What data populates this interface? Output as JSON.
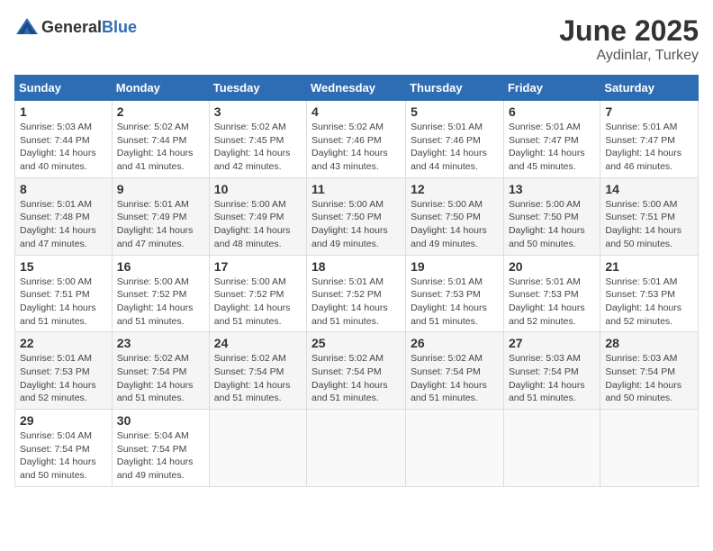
{
  "header": {
    "logo_general": "General",
    "logo_blue": "Blue",
    "month": "June 2025",
    "location": "Aydinlar, Turkey"
  },
  "weekdays": [
    "Sunday",
    "Monday",
    "Tuesday",
    "Wednesday",
    "Thursday",
    "Friday",
    "Saturday"
  ],
  "weeks": [
    [
      {
        "day": "1",
        "sunrise": "5:03 AM",
        "sunset": "7:44 PM",
        "daylight": "14 hours and 40 minutes."
      },
      {
        "day": "2",
        "sunrise": "5:02 AM",
        "sunset": "7:44 PM",
        "daylight": "14 hours and 41 minutes."
      },
      {
        "day": "3",
        "sunrise": "5:02 AM",
        "sunset": "7:45 PM",
        "daylight": "14 hours and 42 minutes."
      },
      {
        "day": "4",
        "sunrise": "5:02 AM",
        "sunset": "7:46 PM",
        "daylight": "14 hours and 43 minutes."
      },
      {
        "day": "5",
        "sunrise": "5:01 AM",
        "sunset": "7:46 PM",
        "daylight": "14 hours and 44 minutes."
      },
      {
        "day": "6",
        "sunrise": "5:01 AM",
        "sunset": "7:47 PM",
        "daylight": "14 hours and 45 minutes."
      },
      {
        "day": "7",
        "sunrise": "5:01 AM",
        "sunset": "7:47 PM",
        "daylight": "14 hours and 46 minutes."
      }
    ],
    [
      {
        "day": "8",
        "sunrise": "5:01 AM",
        "sunset": "7:48 PM",
        "daylight": "14 hours and 47 minutes."
      },
      {
        "day": "9",
        "sunrise": "5:01 AM",
        "sunset": "7:49 PM",
        "daylight": "14 hours and 47 minutes."
      },
      {
        "day": "10",
        "sunrise": "5:00 AM",
        "sunset": "7:49 PM",
        "daylight": "14 hours and 48 minutes."
      },
      {
        "day": "11",
        "sunrise": "5:00 AM",
        "sunset": "7:50 PM",
        "daylight": "14 hours and 49 minutes."
      },
      {
        "day": "12",
        "sunrise": "5:00 AM",
        "sunset": "7:50 PM",
        "daylight": "14 hours and 49 minutes."
      },
      {
        "day": "13",
        "sunrise": "5:00 AM",
        "sunset": "7:50 PM",
        "daylight": "14 hours and 50 minutes."
      },
      {
        "day": "14",
        "sunrise": "5:00 AM",
        "sunset": "7:51 PM",
        "daylight": "14 hours and 50 minutes."
      }
    ],
    [
      {
        "day": "15",
        "sunrise": "5:00 AM",
        "sunset": "7:51 PM",
        "daylight": "14 hours and 51 minutes."
      },
      {
        "day": "16",
        "sunrise": "5:00 AM",
        "sunset": "7:52 PM",
        "daylight": "14 hours and 51 minutes."
      },
      {
        "day": "17",
        "sunrise": "5:00 AM",
        "sunset": "7:52 PM",
        "daylight": "14 hours and 51 minutes."
      },
      {
        "day": "18",
        "sunrise": "5:01 AM",
        "sunset": "7:52 PM",
        "daylight": "14 hours and 51 minutes."
      },
      {
        "day": "19",
        "sunrise": "5:01 AM",
        "sunset": "7:53 PM",
        "daylight": "14 hours and 51 minutes."
      },
      {
        "day": "20",
        "sunrise": "5:01 AM",
        "sunset": "7:53 PM",
        "daylight": "14 hours and 52 minutes."
      },
      {
        "day": "21",
        "sunrise": "5:01 AM",
        "sunset": "7:53 PM",
        "daylight": "14 hours and 52 minutes."
      }
    ],
    [
      {
        "day": "22",
        "sunrise": "5:01 AM",
        "sunset": "7:53 PM",
        "daylight": "14 hours and 52 minutes."
      },
      {
        "day": "23",
        "sunrise": "5:02 AM",
        "sunset": "7:54 PM",
        "daylight": "14 hours and 51 minutes."
      },
      {
        "day": "24",
        "sunrise": "5:02 AM",
        "sunset": "7:54 PM",
        "daylight": "14 hours and 51 minutes."
      },
      {
        "day": "25",
        "sunrise": "5:02 AM",
        "sunset": "7:54 PM",
        "daylight": "14 hours and 51 minutes."
      },
      {
        "day": "26",
        "sunrise": "5:02 AM",
        "sunset": "7:54 PM",
        "daylight": "14 hours and 51 minutes."
      },
      {
        "day": "27",
        "sunrise": "5:03 AM",
        "sunset": "7:54 PM",
        "daylight": "14 hours and 51 minutes."
      },
      {
        "day": "28",
        "sunrise": "5:03 AM",
        "sunset": "7:54 PM",
        "daylight": "14 hours and 50 minutes."
      }
    ],
    [
      {
        "day": "29",
        "sunrise": "5:04 AM",
        "sunset": "7:54 PM",
        "daylight": "14 hours and 50 minutes."
      },
      {
        "day": "30",
        "sunrise": "5:04 AM",
        "sunset": "7:54 PM",
        "daylight": "14 hours and 49 minutes."
      },
      null,
      null,
      null,
      null,
      null
    ]
  ]
}
